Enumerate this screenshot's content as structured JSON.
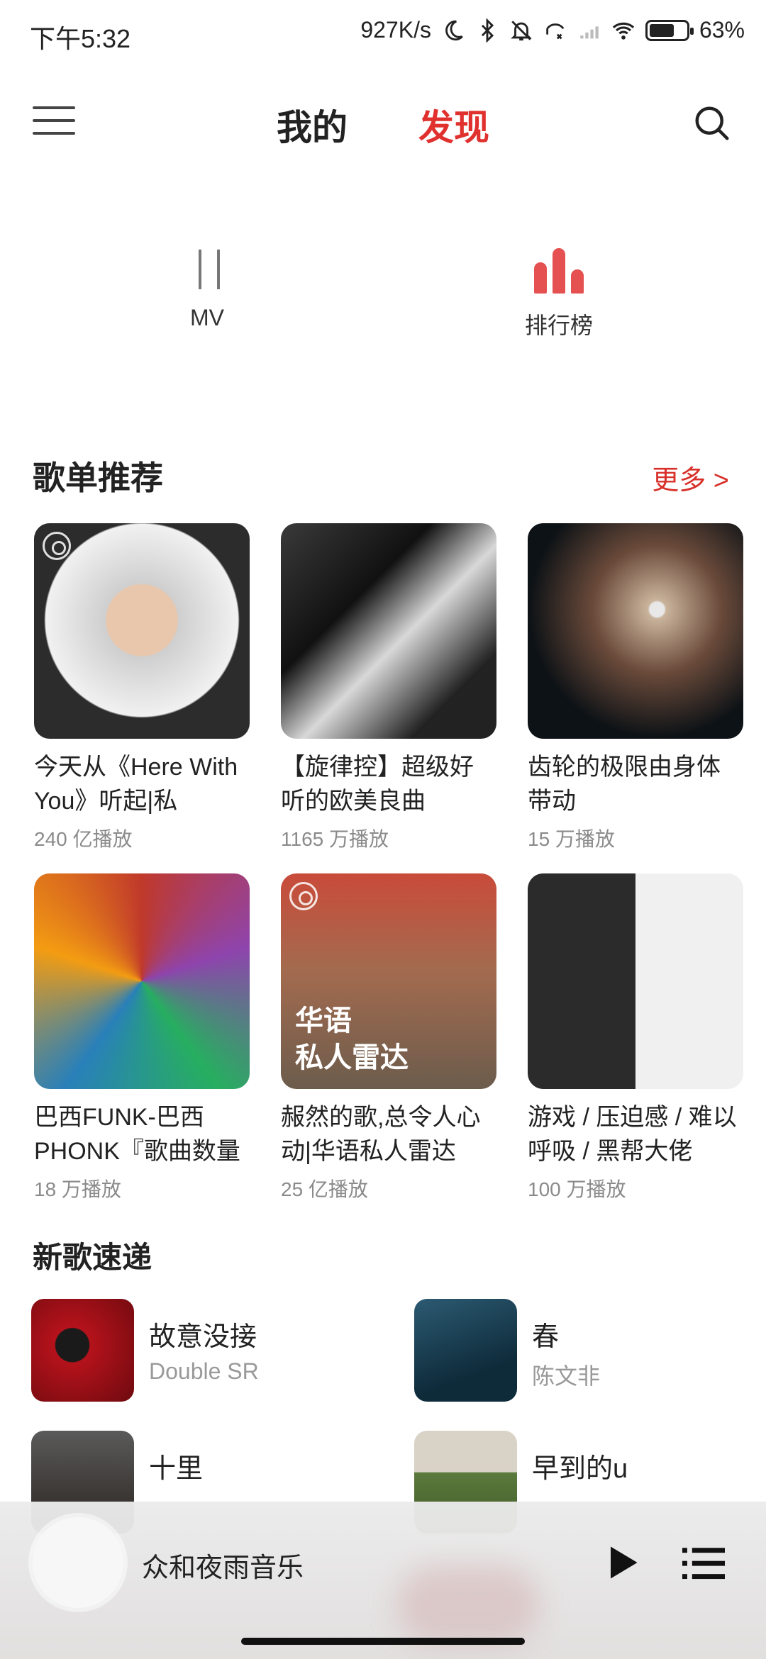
{
  "status_bar": {
    "time": "下午5:32",
    "network_speed": "927K/s",
    "battery": "63%",
    "icons": [
      "moon-icon",
      "bluetooth-icon",
      "bell-muted-icon",
      "call-forward-icon",
      "signal-icon",
      "wifi-icon",
      "battery-icon"
    ]
  },
  "header": {
    "tabs": [
      {
        "label": "我的",
        "active": false
      },
      {
        "label": "发现",
        "active": true
      }
    ],
    "menu_icon": "menu-icon",
    "search_icon": "search-icon",
    "accent_color": "#e0312e"
  },
  "quick_entries": [
    {
      "label": "MV",
      "icon": "mv-icon"
    },
    {
      "label": "排行榜",
      "icon": "chart-bars-icon"
    }
  ],
  "playlists": {
    "title": "歌单推荐",
    "more_label": "更多 >",
    "items": [
      {
        "title": "今天从《Here With You》听起|私",
        "plays": "240 亿播放"
      },
      {
        "title": "【旋律控】超级好听的欧美良曲",
        "plays": "1165 万播放"
      },
      {
        "title": "齿轮的极限由身体带动",
        "plays": "15 万播放"
      },
      {
        "title": "巴西FUNK-巴西PHONK『歌曲数量",
        "plays": "18 万播放"
      },
      {
        "title": "赧然的歌,总令人心动|华语私人雷达",
        "plays": "25 亿播放",
        "cover_text_1": "华语",
        "cover_text_2": "私人雷达"
      },
      {
        "title": "游戏 / 压迫感 / 难以呼吸 / 黑帮大佬",
        "plays": "100 万播放"
      }
    ]
  },
  "new_songs": {
    "title": "新歌速递",
    "items": [
      {
        "name": "故意没接",
        "artist": "Double SR"
      },
      {
        "name": "春",
        "artist": "陈文非"
      },
      {
        "name": "十里",
        "artist": ""
      },
      {
        "name": "早到的u",
        "artist": ""
      }
    ]
  },
  "player": {
    "title": "众和夜雨音乐",
    "play_icon": "play-icon",
    "playlist_icon": "playlist-icon"
  }
}
